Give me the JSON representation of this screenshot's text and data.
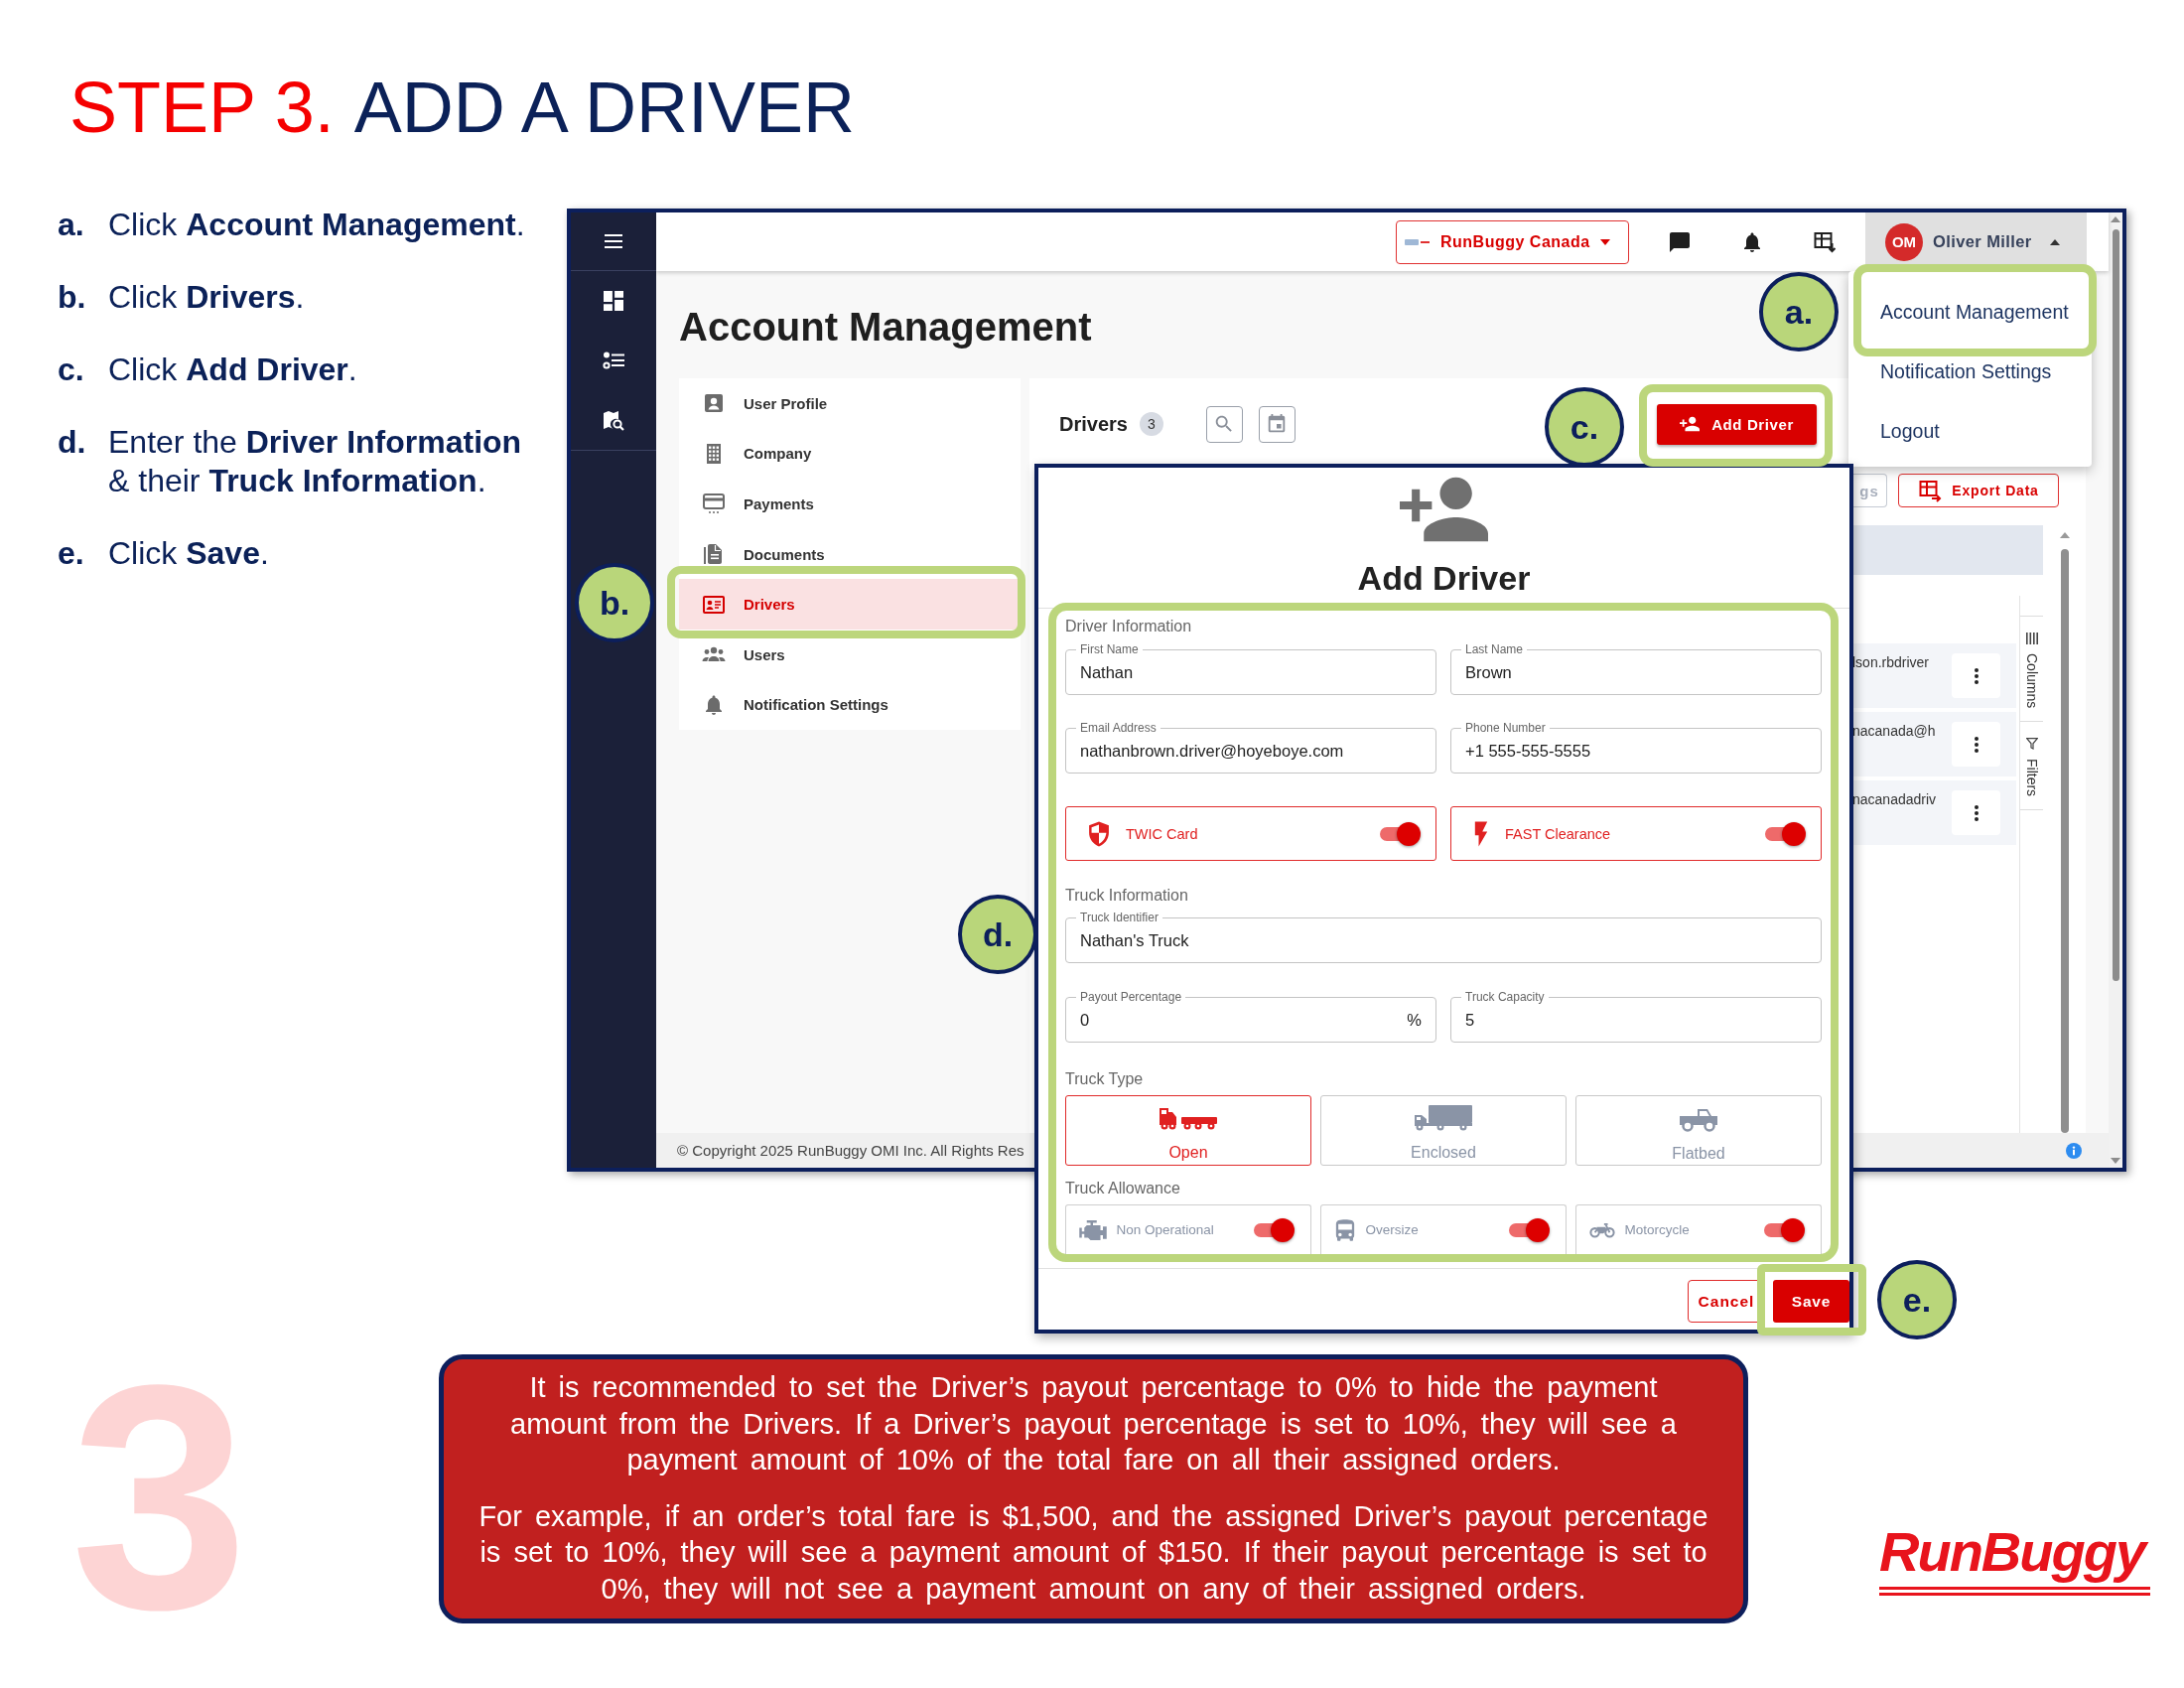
{
  "heading": {
    "step": "STEP 3.",
    "title": "ADD A DRIVER"
  },
  "instructions": [
    {
      "marker": "a.",
      "text": "Click **Account Management**."
    },
    {
      "marker": "b.",
      "text": "Click **Drivers**."
    },
    {
      "marker": "c.",
      "text": "Click **Add Driver**."
    },
    {
      "marker": "d.",
      "text": "Enter the **Driver Information** & their **Truck Information**."
    },
    {
      "marker": "e.",
      "text": "Click **Save**."
    }
  ],
  "app": {
    "top_bar": {
      "company": "RunBuggy Canada",
      "user": {
        "initials": "OM",
        "name": "Oliver Miller"
      }
    },
    "user_menu": [
      "Account Management",
      "Notification Settings",
      "Logout"
    ],
    "page_title": "Account Management",
    "settings_menu": [
      {
        "label": "User Profile",
        "kind": "profile",
        "selected": false
      },
      {
        "label": "Company",
        "kind": "company",
        "selected": false
      },
      {
        "label": "Payments",
        "kind": "payments",
        "selected": false
      },
      {
        "label": "Documents",
        "kind": "documents",
        "selected": false
      },
      {
        "label": "Drivers",
        "kind": "drivers",
        "selected": true
      },
      {
        "label": "Users",
        "kind": "users",
        "selected": false
      },
      {
        "label": "Notification Settings",
        "kind": "notifications",
        "selected": false
      }
    ],
    "drivers_panel": {
      "title": "Drivers",
      "count": "3",
      "add_button": "Add Driver",
      "toolbar_buttons": [
        {
          "label": "gs",
          "kind": "plain"
        },
        {
          "label": "Export Data",
          "kind": "export"
        }
      ],
      "rows": [
        {
          "column_1": "lson.rbdriver"
        },
        {
          "column_1": "nacanada@h"
        },
        {
          "column_1": "nacanadadriv"
        }
      ],
      "side_tabs": [
        {
          "label": "Columns",
          "kind": "columns"
        },
        {
          "label": "Filters",
          "kind": "filters"
        }
      ]
    },
    "footer": "© Copyright 2025 RunBuggy OMI Inc. All Rights Res"
  },
  "dialog": {
    "title": "Add Driver",
    "driver_information": {
      "heading": "Driver Information",
      "fields": [
        {
          "label": "First Name",
          "value": "Nathan"
        },
        {
          "label": "Last Name",
          "value": "Brown"
        },
        {
          "label": "Email Address",
          "value": "nathanbrown.driver@hoyeboye.com"
        },
        {
          "label": "Phone Number",
          "value": "+1 555-555-5555"
        }
      ],
      "toggles": [
        {
          "label": "TWIC Card",
          "kind": "shield",
          "on": true
        },
        {
          "label": "FAST Clearance",
          "kind": "bolt",
          "on": true
        }
      ]
    },
    "truck_information": {
      "heading": "Truck Information",
      "fields": [
        {
          "label": "Truck Identifier",
          "value": "Nathan's Truck"
        },
        {
          "label": "Payout Percentage",
          "value": "0",
          "suffix": "%"
        },
        {
          "label": "Truck Capacity",
          "value": "5"
        }
      ]
    },
    "truck_type": {
      "heading": "Truck Type",
      "options": [
        {
          "label": "Open",
          "kind": "open",
          "selected": true
        },
        {
          "label": "Enclosed",
          "kind": "enclosed",
          "selected": false
        },
        {
          "label": "Flatbed",
          "kind": "flatbed",
          "selected": false
        }
      ]
    },
    "truck_allowance": {
      "heading": "Truck Allowance",
      "options": [
        {
          "label": "Non Operational",
          "kind": "engine",
          "on": true
        },
        {
          "label": "Oversize",
          "kind": "oversize",
          "on": true
        },
        {
          "label": "Motorcycle",
          "kind": "motorcycle",
          "on": true
        }
      ]
    },
    "buttons": [
      {
        "label": "Cancel",
        "kind": "secondary"
      },
      {
        "label": "Save",
        "kind": "primary"
      }
    ]
  },
  "callouts": [
    {
      "label": "a."
    },
    {
      "label": "b."
    },
    {
      "label": "c."
    },
    {
      "label": "d."
    },
    {
      "label": "e."
    }
  ],
  "step_number": "3",
  "note": [
    "It is recommended to set the Driver’s payout percentage to 0% to hide the payment amount from the Drivers. If a Driver’s payout percentage is set to 10%, they will see a payment amount of 10% of the total fare on all their assigned orders.",
    "For example, if an order’s total fare is $1,500, and the assigned Driver’s payout percentage is set to 10%, they will see a payment amount of $150. If their payout percentage is set to 0%, they will not see a payment amount on any of their assigned orders."
  ],
  "logo": "RunBuggy"
}
